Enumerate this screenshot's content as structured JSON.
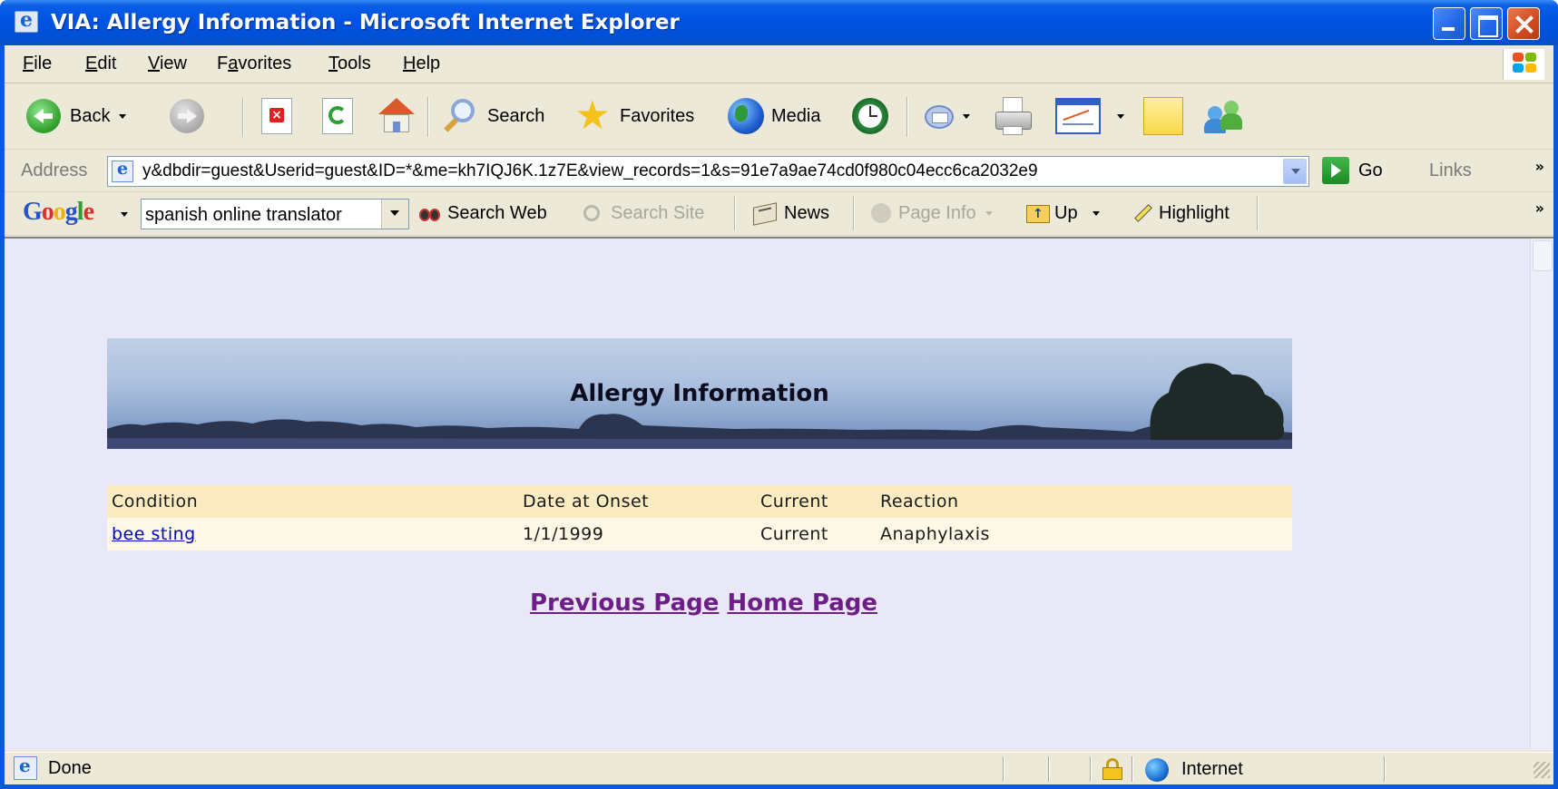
{
  "window": {
    "title": "VIA: Allergy Information - Microsoft Internet Explorer"
  },
  "menu": {
    "items": [
      {
        "pre": "",
        "ul": "F",
        "post": "ile"
      },
      {
        "pre": "",
        "ul": "E",
        "post": "dit"
      },
      {
        "pre": "",
        "ul": "V",
        "post": "iew"
      },
      {
        "pre": "F",
        "ul": "a",
        "post": "vorites"
      },
      {
        "pre": "",
        "ul": "T",
        "post": "ools"
      },
      {
        "pre": "",
        "ul": "H",
        "post": "elp"
      }
    ]
  },
  "toolbar": {
    "back_label": "Back",
    "search_label": "Search",
    "favorites_label": "Favorites",
    "media_label": "Media"
  },
  "address": {
    "label": "Address",
    "url": "y&dbdir=guest&Userid=guest&ID=*&me=kh7IQJ6K.1z7E&view_records=1&s=91e7a9ae74cd0f980c04ecc6ca2032e9",
    "go_label": "Go",
    "links_label": "Links",
    "chevron": "»"
  },
  "google": {
    "logo": "Google",
    "query": "spanish online translator",
    "search_web": "Search Web",
    "search_site": "Search Site",
    "news": "News",
    "page_info": "Page Info",
    "up": "Up",
    "highlight": "Highlight",
    "chevron": "»"
  },
  "page": {
    "banner_title": "Allergy Information",
    "table": {
      "headers": [
        "Condition",
        "Date at Onset",
        "Current",
        "Reaction"
      ],
      "rows": [
        {
          "condition": "bee sting",
          "onset": "1/1/1999",
          "current": "Current",
          "reaction": "Anaphylaxis"
        }
      ]
    },
    "nav": {
      "previous": "Previous Page",
      "home": "Home Page"
    }
  },
  "status": {
    "text": "Done",
    "zone": "Internet"
  },
  "colors": {
    "titlebar": "#0054e3",
    "page_bg": "#e8e8f8",
    "table_header_bg": "#faecc0",
    "table_row_bg": "#fdf9e6",
    "visited_link": "#6e1e87",
    "link": "#0000cc"
  }
}
